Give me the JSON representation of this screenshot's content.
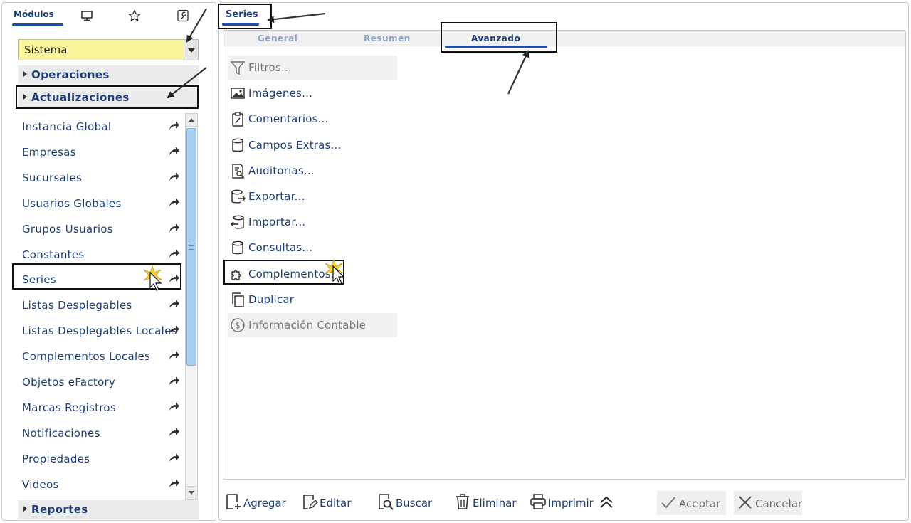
{
  "left_panel": {
    "tab_label": "Módulos",
    "tab_icons": [
      "monitor-icon",
      "star-icon",
      "wrench-icon"
    ],
    "module_select": {
      "value": "Sistema"
    },
    "sections": [
      {
        "label": "Operaciones"
      },
      {
        "label": "Actualizaciones"
      },
      {
        "label": "Reportes"
      }
    ],
    "items": [
      {
        "label": "Instancia Global"
      },
      {
        "label": "Empresas"
      },
      {
        "label": "Sucursales"
      },
      {
        "label": "Usuarios Globales"
      },
      {
        "label": "Grupos Usuarios"
      },
      {
        "label": "Constantes"
      },
      {
        "label": "Series"
      },
      {
        "label": "Listas Desplegables"
      },
      {
        "label": "Listas Desplegables Locales"
      },
      {
        "label": "Complementos Locales"
      },
      {
        "label": "Objetos eFactory"
      },
      {
        "label": "Marcas Registros"
      },
      {
        "label": "Notificaciones"
      },
      {
        "label": "Propiedades"
      },
      {
        "label": "Videos"
      }
    ]
  },
  "right_panel": {
    "tab_label": "Series",
    "subtabs": [
      {
        "label": "General"
      },
      {
        "label": "Resumen"
      },
      {
        "label": "Avanzado",
        "active": true
      }
    ],
    "actions": [
      {
        "label": "Filtros...",
        "icon": "filter-icon",
        "disabled": true
      },
      {
        "label": "Imágenes...",
        "icon": "image-icon"
      },
      {
        "label": "Comentarios...",
        "icon": "clipboard-icon"
      },
      {
        "label": "Campos Extras...",
        "icon": "database-icon"
      },
      {
        "label": "Auditorias...",
        "icon": "audit-icon"
      },
      {
        "label": "Exportar...",
        "icon": "export-icon"
      },
      {
        "label": "Importar...",
        "icon": "import-icon"
      },
      {
        "label": "Consultas...",
        "icon": "database-icon"
      },
      {
        "label": "Complementos...",
        "icon": "puzzle-icon"
      },
      {
        "label": "Duplicar",
        "icon": "copy-icon"
      },
      {
        "label": "Información Contable",
        "icon": "dollar-icon",
        "disabled": true
      }
    ],
    "toolbar": {
      "add": "Agregar",
      "edit": "Editar",
      "search": "Buscar",
      "delete": "Eliminar",
      "print": "Imprimir",
      "accept": "Aceptar",
      "cancel": "Cancelar"
    }
  },
  "colors": {
    "accent": "#1f4ea3",
    "text": "#1f3f7a",
    "select_bg": "#fbf59a",
    "scroll_thumb": "#a9cdee"
  }
}
